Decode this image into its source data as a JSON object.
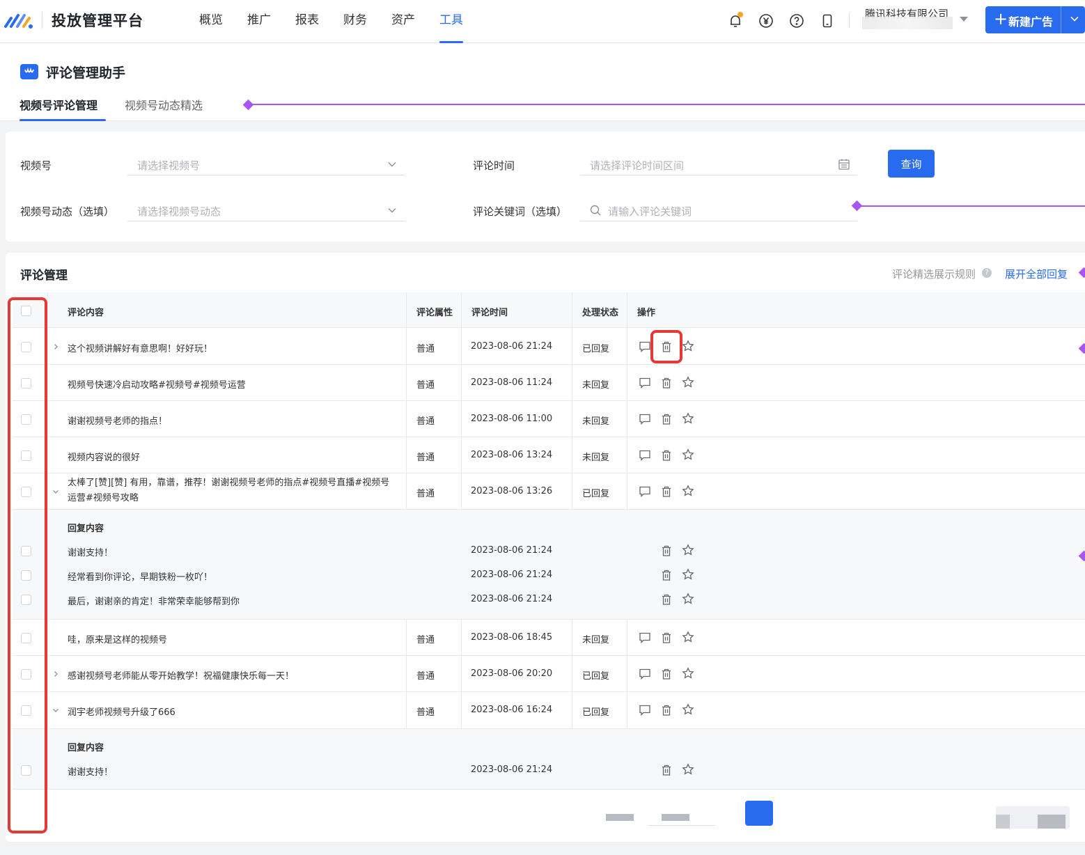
{
  "nav": {
    "brand": "投放管理平台",
    "menu": [
      "概览",
      "推广",
      "报表",
      "财务",
      "资产",
      "工具"
    ],
    "active_menu": "工具",
    "company": "腾讯科技有限公司",
    "new_ad_label": "新建广告"
  },
  "page": {
    "title": "评论管理助手",
    "tabs": [
      "视频号评论管理",
      "视频号动态精选"
    ]
  },
  "filters": {
    "video_label": "视频号",
    "video_placeholder": "请选择视频号",
    "time_label": "评论时间",
    "time_placeholder": "请选择评论时间区间",
    "query_label": "查询",
    "feed_label": "视频号动态（选填）",
    "feed_placeholder": "请选择视频号动态",
    "keyword_label": "评论关键词（选填）",
    "keyword_placeholder": "请输入评论关键词"
  },
  "table": {
    "title": "评论管理",
    "rules_link": "评论精选展示规则",
    "expand_all": "展开全部回复",
    "headers": [
      "评论内容",
      "评论属性",
      "评论时间",
      "处理状态",
      "操作"
    ],
    "reply_section_title": "回复内容",
    "rows": [
      {
        "content": "这个视频讲解好有意思啊！好好玩！",
        "attr": "普通",
        "time": "2023-08-06 21:24",
        "status": "已回复"
      },
      {
        "content": "视频号快速冷启动攻略#视频号#视频号运营",
        "attr": "普通",
        "time": "2023-08-06 11:24",
        "status": "未回复"
      },
      {
        "content": "谢谢视频号老师的指点！",
        "attr": "普通",
        "time": "2023-08-06 11:00",
        "status": "未回复"
      },
      {
        "content": "视频内容说的很好",
        "attr": "普通",
        "time": "2023-08-06 13:24",
        "status": "未回复"
      },
      {
        "content": "太棒了[赞][赞] 有用，靠谱，推荐！谢谢视频号老师的指点#视频号直播#视频号运营#视频号攻略",
        "attr": "普通",
        "time": "2023-08-06 13:26",
        "status": "已回复"
      },
      {
        "content": "哇，原来是这样的视频号",
        "attr": "普通",
        "time": "2023-08-06 18:45",
        "status": "未回复"
      },
      {
        "content": "感谢视频号老师能从零开始教学！祝福健康快乐每一天！",
        "attr": "普通",
        "time": "2023-08-06 20:20",
        "status": "已回复"
      },
      {
        "content": "润宇老师视频号升级了666",
        "attr": "普通",
        "time": "2023-08-06 16:24",
        "status": "已回复"
      }
    ],
    "replies_a": [
      {
        "content": "谢谢支持！",
        "time": "2023-08-06 21:24"
      },
      {
        "content": "经常看到你评论，早期铁粉一枚吖！",
        "time": "2023-08-06 21:24"
      },
      {
        "content": "最后，谢谢亲的肯定！非常荣幸能够帮到你",
        "time": "2023-08-06 21:24"
      }
    ],
    "replies_b": [
      {
        "content": "谢谢支持！",
        "time": "2023-08-06 21:24"
      }
    ]
  },
  "colors": {
    "primary": "#296bef",
    "annotation": "#a855f7",
    "highlight": "#e53935"
  }
}
